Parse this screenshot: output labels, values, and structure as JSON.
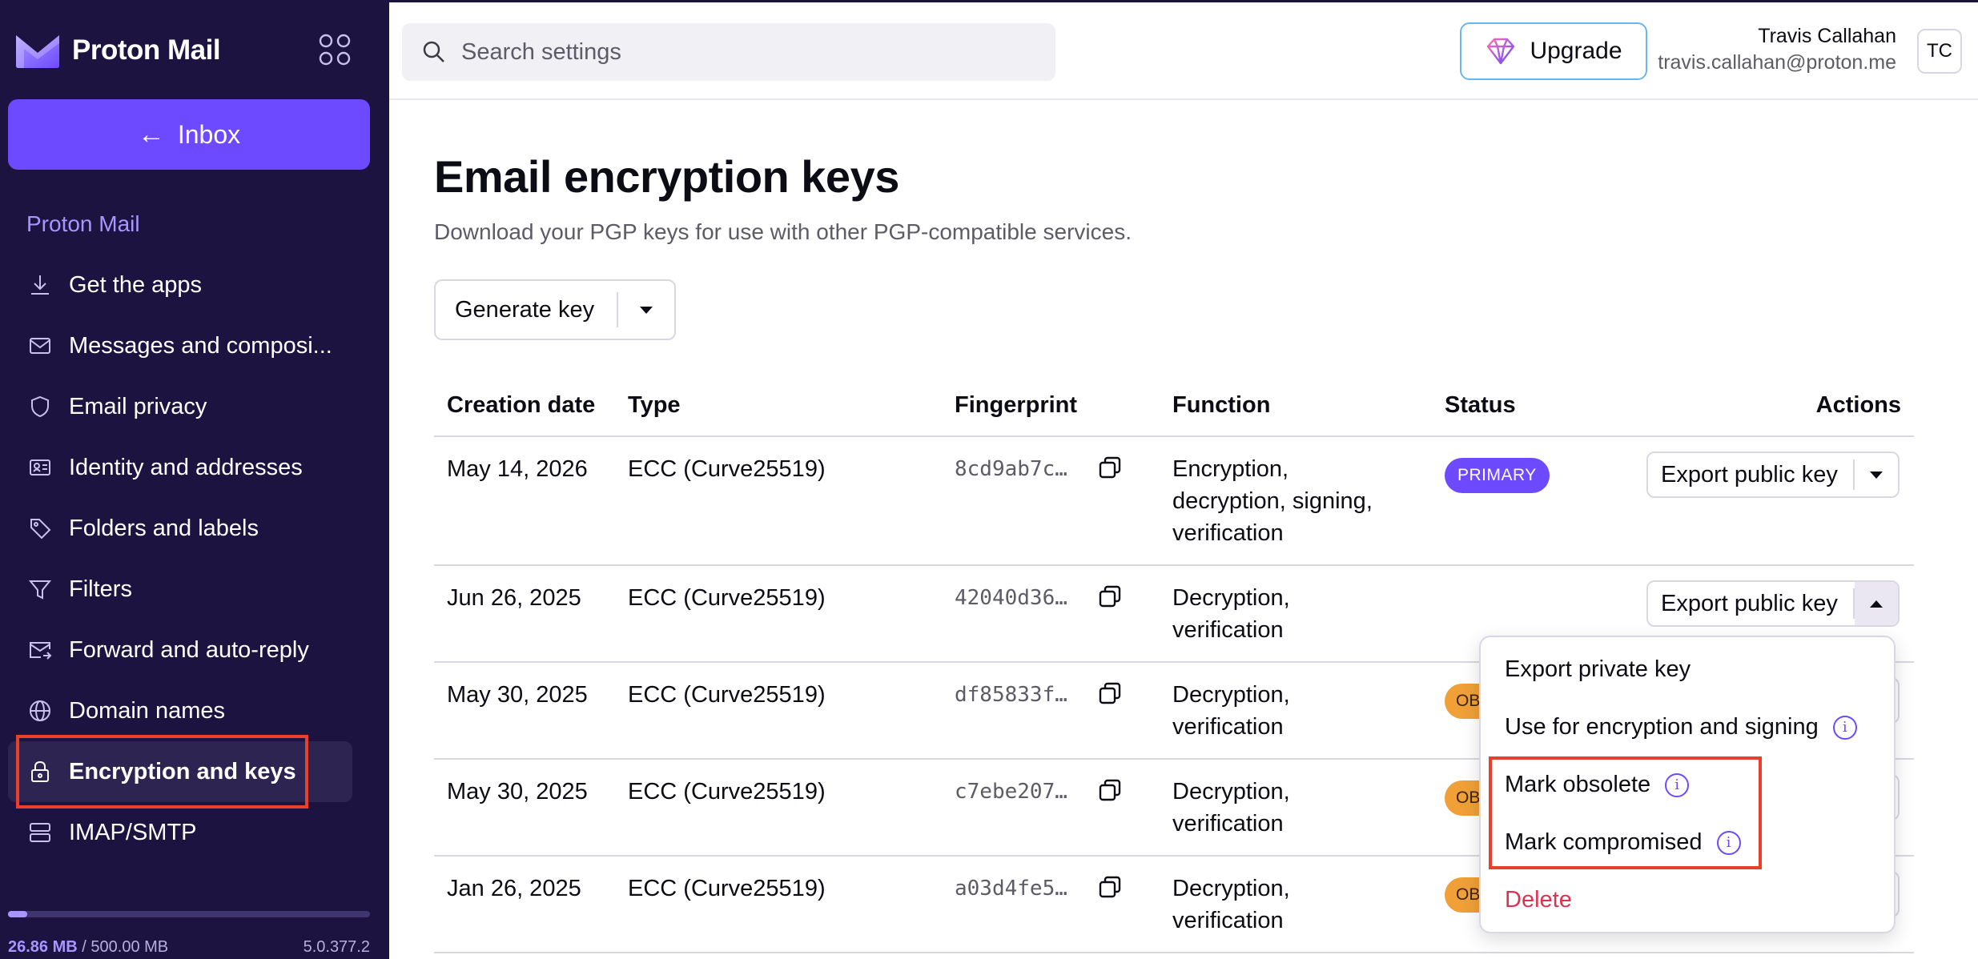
{
  "app": {
    "brand": "Proton Mail"
  },
  "sidebar": {
    "inbox_label": "Inbox",
    "section_label": "Proton Mail",
    "items": [
      {
        "label": "Get the apps",
        "icon": "download-icon"
      },
      {
        "label": "Messages and composi...",
        "icon": "envelope-icon"
      },
      {
        "label": "Email privacy",
        "icon": "shield-icon"
      },
      {
        "label": "Identity and addresses",
        "icon": "id-card-icon"
      },
      {
        "label": "Folders and labels",
        "icon": "tag-icon"
      },
      {
        "label": "Filters",
        "icon": "filter-icon"
      },
      {
        "label": "Forward and auto-reply",
        "icon": "forward-mail-icon"
      },
      {
        "label": "Domain names",
        "icon": "globe-icon"
      },
      {
        "label": "Encryption and keys",
        "icon": "lock-icon",
        "active": true
      },
      {
        "label": "IMAP/SMTP",
        "icon": "servers-icon"
      }
    ],
    "storage_used": "26.86 MB",
    "storage_total": "/ 500.00 MB",
    "storage_fraction": 0.0537,
    "version": "5.0.377.2"
  },
  "header": {
    "search_placeholder": "Search settings",
    "upgrade_label": "Upgrade",
    "user_name": "Travis Callahan",
    "user_email": "travis.callahan@proton.me",
    "avatar_initials": "TC"
  },
  "main": {
    "title": "Email encryption keys",
    "subtitle": "Download your PGP keys for use with other PGP-compatible services.",
    "generate_label": "Generate key",
    "columns": [
      "Creation date",
      "Type",
      "Fingerprint",
      "Function",
      "Status",
      "Actions"
    ],
    "rows": [
      {
        "date": "May 14, 2026",
        "type": "ECC (Curve25519)",
        "fingerprint": "8cd9ab7c…",
        "function": [
          "Encryption,",
          "decryption, signing,",
          "verification"
        ],
        "status": "PRIMARY",
        "action": "Export public key"
      },
      {
        "date": "Jun 26, 2025",
        "type": "ECC (Curve25519)",
        "fingerprint": "42040d36…",
        "function": [
          "Decryption,",
          "verification"
        ],
        "status": "",
        "action": "Export public key"
      },
      {
        "date": "May 30, 2025",
        "type": "ECC (Curve25519)",
        "fingerprint": "df85833f…",
        "function": [
          "Decryption,",
          "verification"
        ],
        "status": "OB",
        "action": ""
      },
      {
        "date": "May 30, 2025",
        "type": "ECC (Curve25519)",
        "fingerprint": "c7ebe207…",
        "function": [
          "Decryption,",
          "verification"
        ],
        "status": "OB",
        "action": ""
      },
      {
        "date": "Jan 26, 2025",
        "type": "ECC (Curve25519)",
        "fingerprint": "a03d4fe5…",
        "function": [
          "Decryption,",
          "verification"
        ],
        "status": "OB",
        "action": ""
      }
    ]
  },
  "dropdown": {
    "items": [
      {
        "label": "Export private key",
        "info": false
      },
      {
        "label": "Use for encryption and signing",
        "info": true
      },
      {
        "label": "Mark obsolete",
        "info": true
      },
      {
        "label": "Mark compromised",
        "info": true
      },
      {
        "label": "Delete",
        "info": false,
        "danger": true
      }
    ]
  },
  "colors": {
    "sidebar_bg": "#1c1340",
    "accent": "#6d4aff",
    "highlight": "#e8402a",
    "obsolete": "#f0a037",
    "danger": "#dc3251"
  }
}
